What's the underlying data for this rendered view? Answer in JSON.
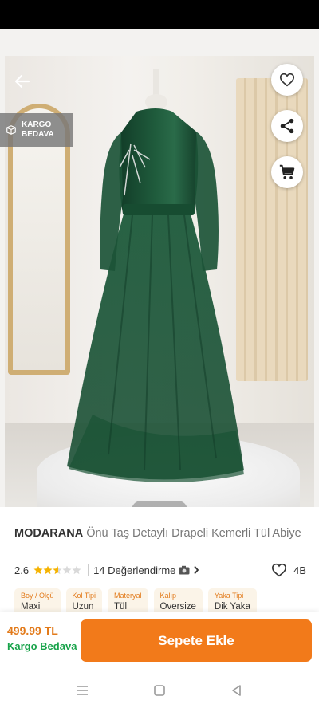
{
  "colors": {
    "accent": "#f27a1a",
    "accent_text": "#e27a1a",
    "success": "#18a34a",
    "dress": "#1f5b3c"
  },
  "gallery": {
    "badge_line1": "KARGO",
    "badge_line2": "BEDAVA",
    "page_count": 3,
    "current_page": 1,
    "icons": {
      "back": "arrow-left-icon",
      "favorite": "heart-icon",
      "share": "share-icon",
      "cart": "cart-icon",
      "badge": "box-icon"
    }
  },
  "product": {
    "brand": "MODARANA",
    "name": "Önü Taş Detaylı Drapeli Kemerli Tül Abiye",
    "rating": "2.6",
    "rating_value": 2.6,
    "rating_max": 5,
    "review_text": "14 Değerlendirme",
    "favorite_count": "4B"
  },
  "attributes": [
    {
      "label": "Boy / Ölçü",
      "value": "Maxi"
    },
    {
      "label": "Kol Tipi",
      "value": "Uzun"
    },
    {
      "label": "Materyal",
      "value": "Tül"
    },
    {
      "label": "Kalıp",
      "value": "Oversize"
    },
    {
      "label": "Yaka Tipi",
      "value": "Dik Yaka"
    }
  ],
  "bottom_bar": {
    "price": "499.99 TL",
    "shipping": "Kargo Bedava",
    "add_to_cart": "Sepete Ekle"
  }
}
